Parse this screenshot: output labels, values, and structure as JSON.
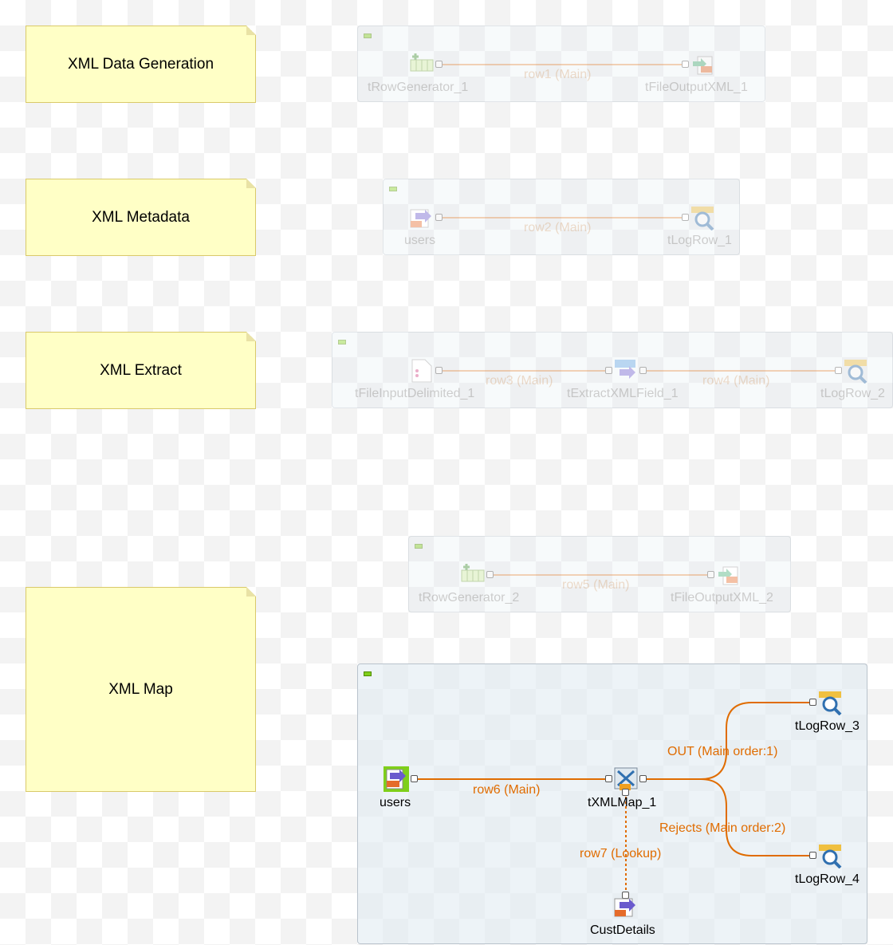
{
  "notes": {
    "gen": "XML Data Generation",
    "meta": "XML Metadata",
    "extract": "XML Extract",
    "map": "XML Map"
  },
  "job1": {
    "c1": "tRowGenerator_1",
    "c2": "tFileOutputXML_1",
    "link": "row1 (Main)"
  },
  "job2": {
    "c1": "users",
    "c2": "tLogRow_1",
    "link": "row2 (Main)"
  },
  "job3": {
    "c1": "tFileInputDelimited_1",
    "c2": "tExtractXMLField_1",
    "c3": "tLogRow_2",
    "link1": "row3 (Main)",
    "link2": "row4 (Main)"
  },
  "job4": {
    "c1": "tRowGenerator_2",
    "c2": "tFileOutputXML_2",
    "link": "row5 (Main)"
  },
  "job5": {
    "users": "users",
    "map": "tXMLMap_1",
    "log3": "tLogRow_3",
    "log4": "tLogRow_4",
    "cust": "CustDetails",
    "link_row6": "row6 (Main)",
    "link_out": "OUT (Main order:1)",
    "link_rejects": "Rejects (Main order:2)",
    "link_row7": "row7 (Lookup)"
  },
  "colors": {
    "link": "#e06c00",
    "note_bg": "#ffffc6",
    "subjob_bg": "#deeaf0"
  }
}
